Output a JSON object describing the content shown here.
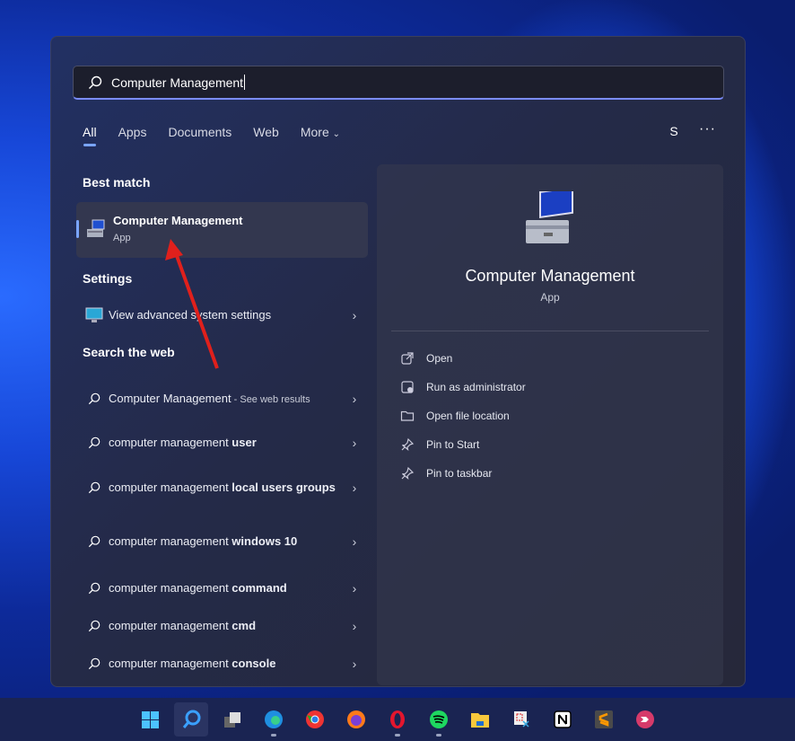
{
  "search": {
    "value": "Computer Management"
  },
  "tabs": [
    {
      "label": "All",
      "active": true
    },
    {
      "label": "Apps"
    },
    {
      "label": "Documents"
    },
    {
      "label": "Web"
    },
    {
      "label": "More"
    }
  ],
  "account": {
    "initial": "S"
  },
  "more_options": "···",
  "best_match": {
    "heading": "Best match",
    "title": "Computer Management",
    "type": "App"
  },
  "settings": {
    "heading": "Settings",
    "item": "View advanced system settings"
  },
  "web": {
    "heading": "Search the web",
    "items": [
      {
        "normal": "Computer Management",
        "suffix": " - See web results",
        "bold": ""
      },
      {
        "normal": "computer management ",
        "bold": "user"
      },
      {
        "normal": "computer management ",
        "bold": "local users groups"
      },
      {
        "normal": "computer management ",
        "bold": "windows 10"
      },
      {
        "normal": "computer management ",
        "bold": "command"
      },
      {
        "normal": "computer management ",
        "bold": "cmd"
      },
      {
        "normal": "computer management ",
        "bold": "console"
      }
    ]
  },
  "details": {
    "title": "Computer Management",
    "type": "App",
    "actions": [
      {
        "label": "Open",
        "icon": "open-external-icon"
      },
      {
        "label": "Run as administrator",
        "icon": "shield-window-icon"
      },
      {
        "label": "Open file location",
        "icon": "folder-icon"
      },
      {
        "label": "Pin to Start",
        "icon": "pin-icon"
      },
      {
        "label": "Pin to taskbar",
        "icon": "pin-icon"
      }
    ]
  },
  "taskbar": {
    "apps": [
      "Start",
      "Search",
      "Task View",
      "Edge",
      "Chrome",
      "Firefox",
      "Opera",
      "Spotify",
      "File Explorer",
      "Snipping Tool",
      "Notion",
      "Sublime Text",
      "Screen recorder"
    ]
  },
  "colors": {
    "accent": "#7aa5ff",
    "annotation_arrow": "#e0201c"
  }
}
